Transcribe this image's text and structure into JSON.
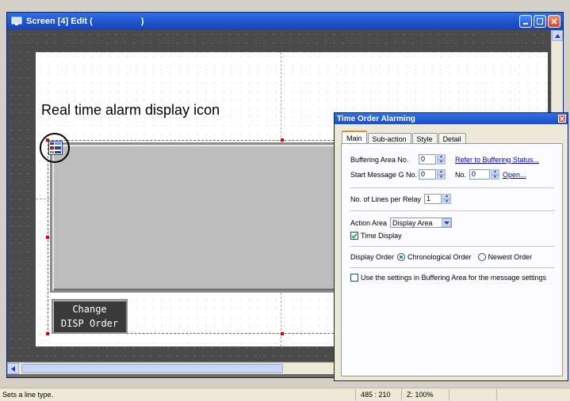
{
  "window": {
    "title": "Screen [4] Edit (                    )"
  },
  "canvas": {
    "annotation": "Real time alarm display icon",
    "change_button": {
      "line1": "Change",
      "line2": "DISP Order"
    }
  },
  "dialog": {
    "title": "Time Order Alarming",
    "tabs": [
      "Main",
      "Sub-action",
      "Style",
      "Detail"
    ],
    "active_tab": "Main",
    "buffering_area_label": "Buffering Area No.",
    "buffering_area_value": "0",
    "refer_link": "Refer to Buffering Status...",
    "start_message_label": "Start Message  G No.",
    "g_no_value": "0",
    "no_label": "No.",
    "no_value": "0",
    "open_link": "Open...",
    "lines_per_relay_label": "No. of Lines per Relay",
    "lines_per_relay_value": "1",
    "action_area_label": "Action Area",
    "action_area_value": "Display Area",
    "time_display_label": "Time Display",
    "time_display_checked": true,
    "display_order_label": "Display Order",
    "chronological_label": "Chronological Order",
    "newest_label": "Newest Order",
    "display_order_selected": "Chronological Order",
    "use_settings_label": "Use the settings in Buffering Area for the message settings",
    "use_settings_checked": false
  },
  "statusbar": {
    "message": "Sets a line type.",
    "coords": "485 : 210",
    "zoom": "Z: 100%"
  },
  "icons": {
    "app": "screen-edit-icon",
    "minimize": "minimize-icon",
    "restore": "restore-icon",
    "close": "close-icon",
    "alarm": "real-time-alarm-icon"
  },
  "colors": {
    "titlebar": "#1e50c8",
    "workspace": "#4b4b4b",
    "alarm_fill": "#bdbdbd",
    "handles": "#e00000",
    "link": "#0000c8"
  }
}
